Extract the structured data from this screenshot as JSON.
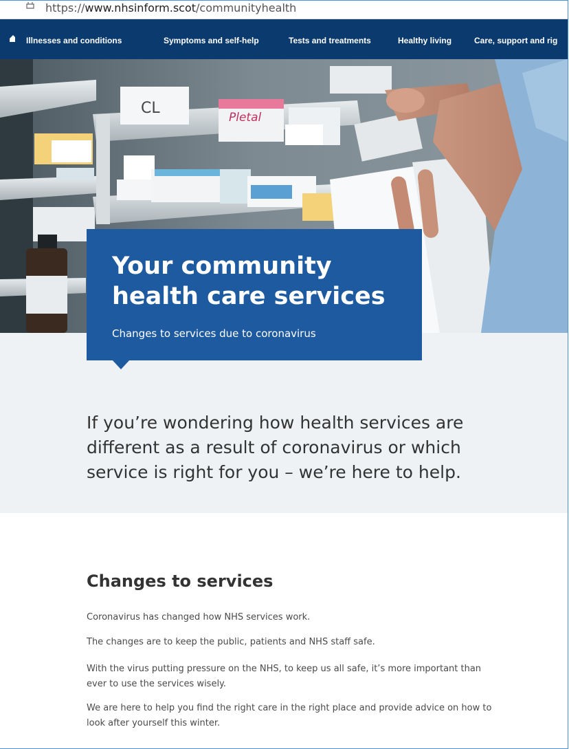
{
  "browser": {
    "url_prefix": "https://",
    "url_host": "www.nhsinform.scot",
    "url_path": "/communityhealth"
  },
  "nav": {
    "items": [
      {
        "label": "Illnesses and conditions"
      },
      {
        "label": "Symptoms and self-help"
      },
      {
        "label": "Tests and treatments"
      },
      {
        "label": "Healthy living"
      },
      {
        "label": "Care, support and rig"
      }
    ]
  },
  "hero": {
    "title_line1": "Your community",
    "title_line2": "health care services",
    "subtitle": "Changes to services due to coronavirus"
  },
  "lead": {
    "text": "If you’re wondering how health services are different as a result of coronavirus or which service is right for you – we’re here to help."
  },
  "content": {
    "heading": "Changes to services",
    "paragraphs": [
      "Coronavirus has changed how NHS services work.",
      "The changes are to keep the public, patients and NHS staff safe.",
      "With the virus putting pressure on the NHS, to keep us all safe, it’s more important than ever to use the services wisely.",
      "We are here to help you find the right care in the right place and provide advice on how to look after yourself this winter."
    ]
  },
  "colors": {
    "nav_bg": "#0b3b6e",
    "title_box": "#1d5aa0",
    "light_section": "#eef2f4"
  },
  "icons": {
    "lock": "lock-icon",
    "home": "home-icon"
  }
}
